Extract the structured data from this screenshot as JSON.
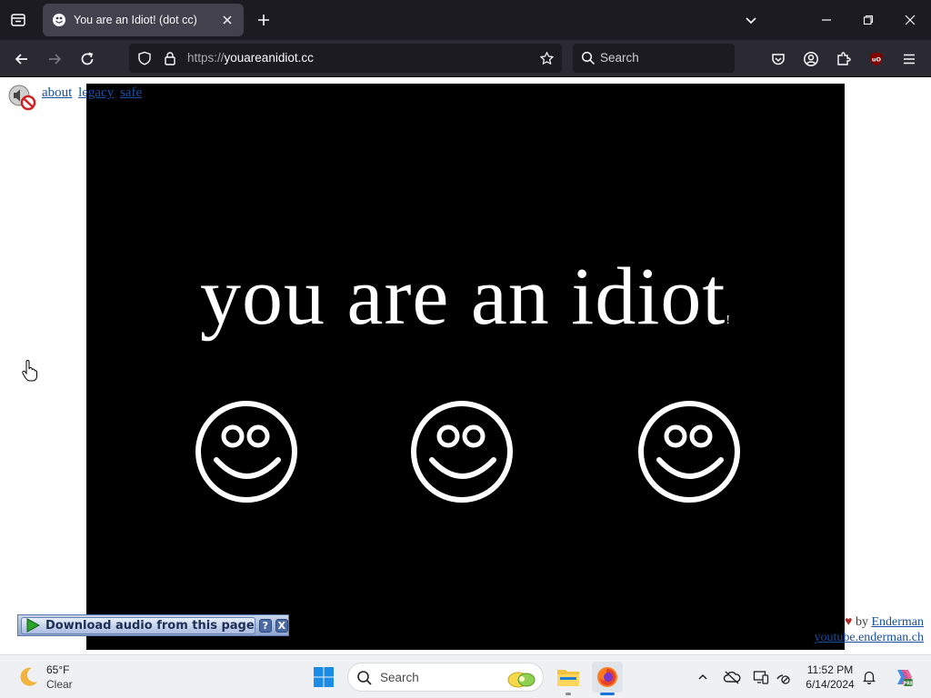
{
  "browser": {
    "tab": {
      "title": "You are an Idiot! (dot cc)"
    },
    "url": {
      "scheme": "https://",
      "host": "youareanidiot.cc"
    },
    "search": {
      "placeholder": "Search"
    },
    "icons": {
      "tab_list": "tab-list-icon",
      "favicon": "smiley-icon",
      "close_tab": "close-icon",
      "new_tab": "plus-icon",
      "list_all_tabs": "chevron-down-icon",
      "minimize": "minimize-icon",
      "maximize": "restore-icon",
      "close_window": "close-icon",
      "back": "back-arrow-icon",
      "forward": "forward-arrow-icon",
      "reload": "reload-icon",
      "tracking": "shield-icon",
      "lock": "lock-icon",
      "bookmark": "star-icon",
      "pocket": "pocket-icon",
      "account": "account-icon",
      "extensions": "extensions-icon",
      "ublock": "ublock-icon",
      "menu": "hamburger-menu-icon"
    }
  },
  "page": {
    "links": [
      "about",
      "legacy",
      "safe"
    ],
    "headline": "you are an idiot",
    "headline_mark": "!",
    "credit": {
      "by": "by",
      "author": "Enderman",
      "site": "youtube.enderman.ch"
    },
    "download_bar": {
      "label": "Download audio from this page",
      "help": "?",
      "close": "X"
    },
    "colors": {
      "stage": "#000000",
      "headline": "#ffffff",
      "link": "#1a4fa0"
    }
  },
  "taskbar": {
    "weather": {
      "temp": "65°F",
      "condition": "Clear",
      "icon": "moon-icon"
    },
    "search": {
      "placeholder": "Search"
    },
    "apps": [
      "windows-start",
      "file-explorer",
      "firefox"
    ],
    "tray": [
      "chevron-up-icon",
      "onedrive-icon",
      "display-icon",
      "network-icon",
      "notification-bell-icon",
      "copilot-icon"
    ],
    "clock": {
      "time": "11:52 PM",
      "date": "6/14/2024"
    }
  }
}
